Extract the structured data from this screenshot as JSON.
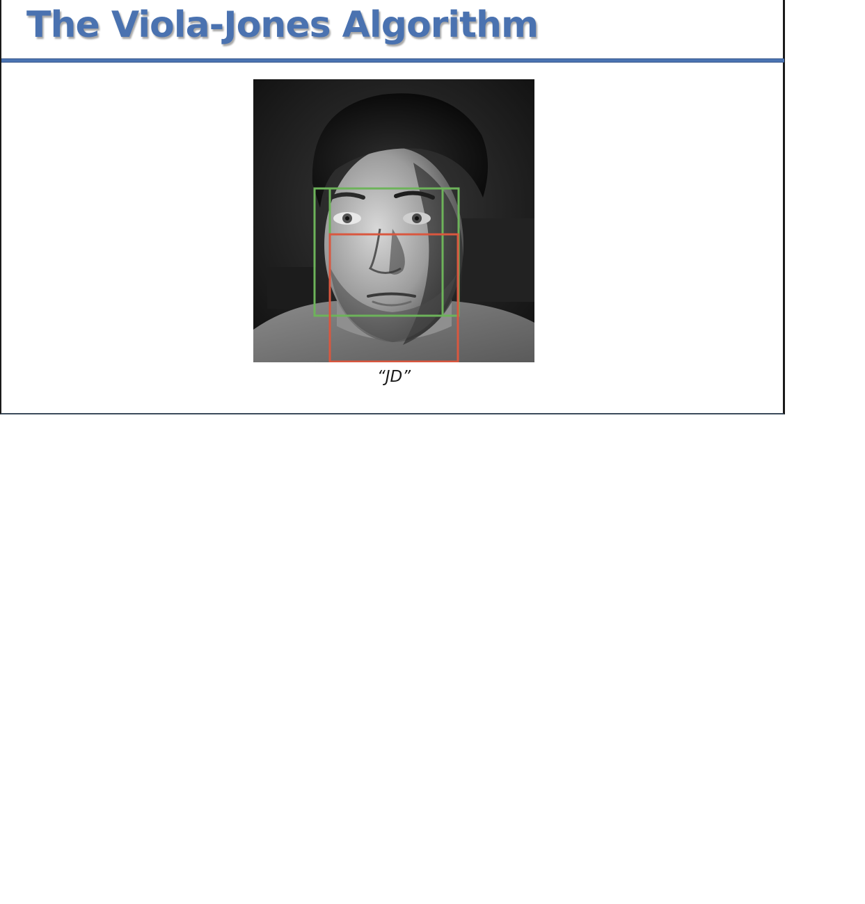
{
  "slide": {
    "title": "The Viola-Jones Algorithm",
    "caption": "“JD”"
  },
  "photo": {
    "subject": "grayscale portrait photo of a face",
    "detection_boxes": [
      {
        "name": "green-box-1",
        "color": "#6db35a"
      },
      {
        "name": "green-box-2",
        "color": "#6db35a"
      },
      {
        "name": "red-box",
        "color": "#d9573f"
      }
    ]
  },
  "colors": {
    "title": "#4a72b0",
    "rule": "#4b74b2",
    "green_box": "#6db35a",
    "red_box": "#d9573f"
  }
}
